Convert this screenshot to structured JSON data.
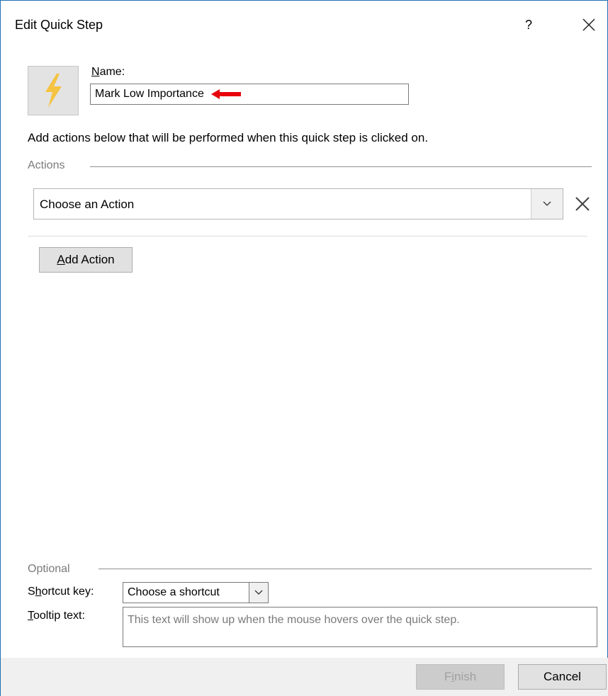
{
  "window": {
    "title": "Edit Quick Step",
    "help_label": "?",
    "close_icon": "close-icon"
  },
  "name_section": {
    "icon": "lightning-bolt-icon",
    "icon_color": "#f5c342",
    "label_accesskey": "N",
    "label_rest": "ame:",
    "value": "Mark Low Importance",
    "annotation_arrow_color": "#e8000b"
  },
  "instruction": "Add actions below that will be performed when this quick step is clicked on.",
  "actions": {
    "group_label": "Actions",
    "selected_action": "Choose an Action",
    "dropdown_icon": "chevron-down-icon",
    "remove_icon": "close-icon",
    "add_action_accesskey": "A",
    "add_action_rest": "dd Action"
  },
  "optional": {
    "group_label": "Optional",
    "shortcut_label_pre": "S",
    "shortcut_label_accesskey": "h",
    "shortcut_label_rest": "ortcut key:",
    "shortcut_value": "Choose a shortcut",
    "tooltip_label_accesskey": "T",
    "tooltip_label_rest": "ooltip text:",
    "tooltip_placeholder": "This text will show up when the mouse hovers over the quick step."
  },
  "footer": {
    "finish_pre": "F",
    "finish_accesskey": "i",
    "finish_rest": "nish",
    "cancel_label": "Cancel"
  }
}
